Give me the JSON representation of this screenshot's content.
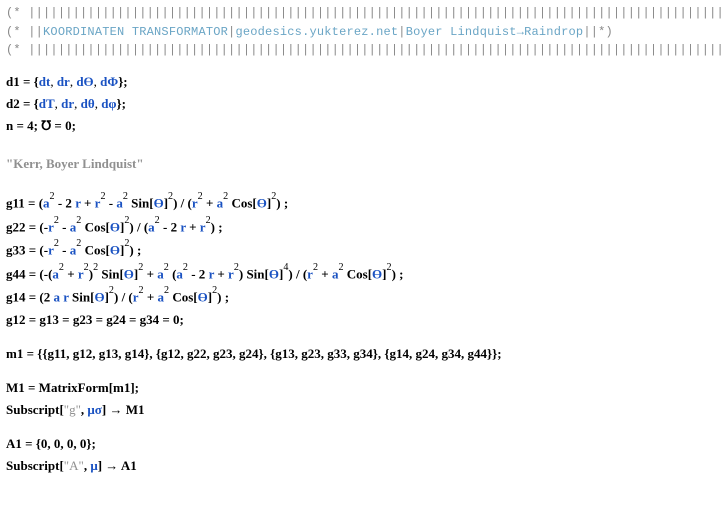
{
  "header": {
    "bar1_open": "(* ",
    "bar1_pipes": "||||||||||||||||||||||||||||||||||||||||||||||||||||||||||||||||||||||||||||||||||||||||||||||||||||||||",
    "bar1_close": "| *)",
    "bar2_open": "(* ||",
    "bar2_label_kt": "KOORDINATEN TRANSFORMATOR",
    "bar2_sep1": "|",
    "bar2_url": "geodesics.yukterez.net",
    "bar2_sep2": "|",
    "bar2_bl": "Boyer Lindquist→Raindrop",
    "bar2_close": "||*)"
  },
  "d1": {
    "lhs": "d1 = {",
    "e1v": "dt",
    "c1": ", ",
    "e2v": "dr",
    "c2": ", ",
    "e3v": "dϴ",
    "c3": ", ",
    "e4v": "dΦ",
    "rhs": "};"
  },
  "d2": {
    "lhs": "d2 = {",
    "e1v": "dT",
    "c1": ", ",
    "e2v": "dr",
    "c2": ", ",
    "e3v": "dθ",
    "c3": ", ",
    "e4v": "dφ",
    "rhs": "};"
  },
  "nline": {
    "text_a": "n = 4;  ",
    "mho": "℧",
    "text_b": " = 0;"
  },
  "kerr_label": "\"Kerr, Boyer Lindquist\"",
  "g11": {
    "p1": "g11 = (",
    "a": "a",
    "sq1": "2",
    "p2": " - 2 ",
    "r1": "r",
    "p3": " + ",
    "r2": "r",
    "sq2": "2",
    "p4": " - ",
    "a2": "a",
    "sq3": "2",
    "p5": " Sin[",
    "th1": "ϴ",
    "p6": "]",
    "sq4": "2",
    "p7": ") / (",
    "r3": "r",
    "sq5": "2",
    "p8": " + ",
    "a3": "a",
    "sq6": "2",
    "p9": " Cos[",
    "th2": "ϴ",
    "p10": "]",
    "sq7": "2",
    "p11": ") ;"
  },
  "g22": {
    "p1": "g22 = (-",
    "r1": "r",
    "sq1": "2",
    "p2": " - ",
    "a1": "a",
    "sq2": "2",
    "p3": " Cos[",
    "th1": "ϴ",
    "p4": "]",
    "sq3": "2",
    "p5": ") / (",
    "a2": "a",
    "sq4": "2",
    "p6": " - 2 ",
    "r2": "r",
    "p7": " + ",
    "r3": "r",
    "sq5": "2",
    "p8": ") ;"
  },
  "g33": {
    "p1": "g33 = (-",
    "r1": "r",
    "sq1": "2",
    "p2": " - ",
    "a1": "a",
    "sq2": "2",
    "p3": " Cos[",
    "th1": "ϴ",
    "p4": "]",
    "sq3": "2",
    "p5": ") ;"
  },
  "g44": {
    "p1": "g44 = (-(",
    "a1": "a",
    "sq1": "2",
    "p2": " + ",
    "r1": "r",
    "sq2": "2",
    "p3": ")",
    "sq3": "2",
    "p4": " Sin[",
    "th1": "ϴ",
    "p5": "]",
    "sq4": "2",
    "p6": " + ",
    "a2": "a",
    "sq5": "2",
    "p7": " (",
    "a3": "a",
    "sq6": "2",
    "p8": " - 2 ",
    "r2": "r",
    "p9": " + ",
    "r3": "r",
    "sq7": "2",
    "p10": ") Sin[",
    "th2": "ϴ",
    "p11": "]",
    "sq8": "4",
    "p12": ") / (",
    "r4": "r",
    "sq9": "2",
    "p13": " + ",
    "a4": "a",
    "sq10": "2",
    "p14": " Cos[",
    "th3": "ϴ",
    "p15": "]",
    "sq11": "2",
    "p16": ") ;"
  },
  "g14": {
    "p1": "g14 = (2 ",
    "a1": "a",
    "sp1": " ",
    "r1": "r",
    "p2": " Sin[",
    "th1": "ϴ",
    "p3": "]",
    "sq1": "2",
    "p4": ") / (",
    "r2": "r",
    "sq2": "2",
    "p5": " + ",
    "a2": "a",
    "sq3": "2",
    "p6": " Cos[",
    "th2": "ϴ",
    "p7": "]",
    "sq4": "2",
    "p8": ") ;"
  },
  "gzero": "g12 = g13 = g23 = g24 = g34 = 0;",
  "m1": "m1 = {{g11, g12, g13, g14}, {g12, g22, g23, g24}, {g13, g23, g33, g34}, {g14, g24, g34, g44}};",
  "M1_line": "M1 = MatrixForm[m1];",
  "sub_g": {
    "p1": "Subscript[",
    "q1": "\"g\"",
    "p2": ", ",
    "mu": "μσ",
    "p3": "] ",
    "arrow": "→",
    "p4": " M1"
  },
  "A1_line": "A1 = {0, 0, 0, 0};",
  "sub_A": {
    "p1": "Subscript[",
    "q1": "\"A\"",
    "p2": ", ",
    "mu": "μ",
    "p3": "] ",
    "arrow": "→",
    "p4": " A1"
  }
}
